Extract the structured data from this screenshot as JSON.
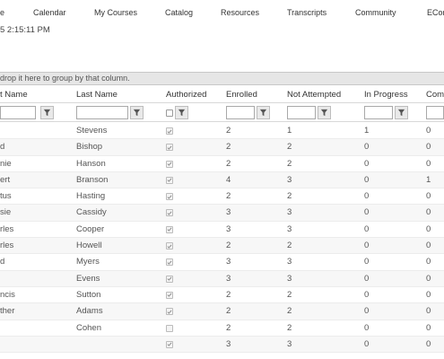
{
  "nav": [
    {
      "key": "n0",
      "label": "e"
    },
    {
      "key": "n1",
      "label": "Calendar"
    },
    {
      "key": "n2",
      "label": "My Courses"
    },
    {
      "key": "n3",
      "label": "Catalog"
    },
    {
      "key": "n4",
      "label": "Resources"
    },
    {
      "key": "n5",
      "label": "Transcripts"
    },
    {
      "key": "n6",
      "label": "Community"
    },
    {
      "key": "n7",
      "label": "EConn"
    }
  ],
  "timestamp": "5 2:15:11 PM",
  "group_hint": "drop it here to group by that column.",
  "columns": [
    "t Name",
    "Last Name",
    "Authorized",
    "Enrolled",
    "Not Attempted",
    "In Progress",
    "Comp"
  ],
  "rows": [
    {
      "first": "",
      "last": "Stevens",
      "auth": true,
      "enrolled": "2",
      "not_attempted": "1",
      "in_progress": "1",
      "comp": "0"
    },
    {
      "first": "d",
      "last": "Bishop",
      "auth": true,
      "enrolled": "2",
      "not_attempted": "2",
      "in_progress": "0",
      "comp": "0"
    },
    {
      "first": "nie",
      "last": "Hanson",
      "auth": true,
      "enrolled": "2",
      "not_attempted": "2",
      "in_progress": "0",
      "comp": "0"
    },
    {
      "first": "ert",
      "last": "Branson",
      "auth": true,
      "enrolled": "4",
      "not_attempted": "3",
      "in_progress": "0",
      "comp": "1"
    },
    {
      "first": "tus",
      "last": "Hasting",
      "auth": true,
      "enrolled": "2",
      "not_attempted": "2",
      "in_progress": "0",
      "comp": "0"
    },
    {
      "first": "sie",
      "last": "Cassidy",
      "auth": true,
      "enrolled": "3",
      "not_attempted": "3",
      "in_progress": "0",
      "comp": "0"
    },
    {
      "first": "rles",
      "last": "Cooper",
      "auth": true,
      "enrolled": "3",
      "not_attempted": "3",
      "in_progress": "0",
      "comp": "0"
    },
    {
      "first": "rles",
      "last": "Howell",
      "auth": true,
      "enrolled": "2",
      "not_attempted": "2",
      "in_progress": "0",
      "comp": "0"
    },
    {
      "first": "d",
      "last": "Myers",
      "auth": true,
      "enrolled": "3",
      "not_attempted": "3",
      "in_progress": "0",
      "comp": "0"
    },
    {
      "first": "",
      "last": "Evens",
      "auth": true,
      "enrolled": "3",
      "not_attempted": "3",
      "in_progress": "0",
      "comp": "0"
    },
    {
      "first": "ncis",
      "last": "Sutton",
      "auth": true,
      "enrolled": "2",
      "not_attempted": "2",
      "in_progress": "0",
      "comp": "0"
    },
    {
      "first": "ther",
      "last": "Adams",
      "auth": true,
      "enrolled": "2",
      "not_attempted": "2",
      "in_progress": "0",
      "comp": "0"
    },
    {
      "first": "",
      "last": "Cohen",
      "auth": false,
      "enrolled": "2",
      "not_attempted": "2",
      "in_progress": "0",
      "comp": "0"
    },
    {
      "first": "",
      "last": "",
      "auth": true,
      "enrolled": "3",
      "not_attempted": "3",
      "in_progress": "0",
      "comp": "0"
    }
  ]
}
